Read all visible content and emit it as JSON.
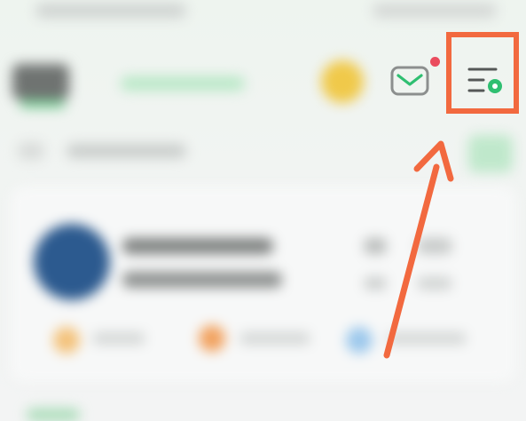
{
  "screen": {
    "blurred": true
  },
  "header": {
    "mail_icon": "envelope-icon",
    "mail_unread_dot_color": "#ea4c5e",
    "menu_settings_icon": "list-settings-icon",
    "accent_color": "#2fbf71"
  },
  "annotation": {
    "highlight_color": "#f2693f",
    "target": "menu-settings-button",
    "arrow_icon": "arrow-up-icon"
  }
}
